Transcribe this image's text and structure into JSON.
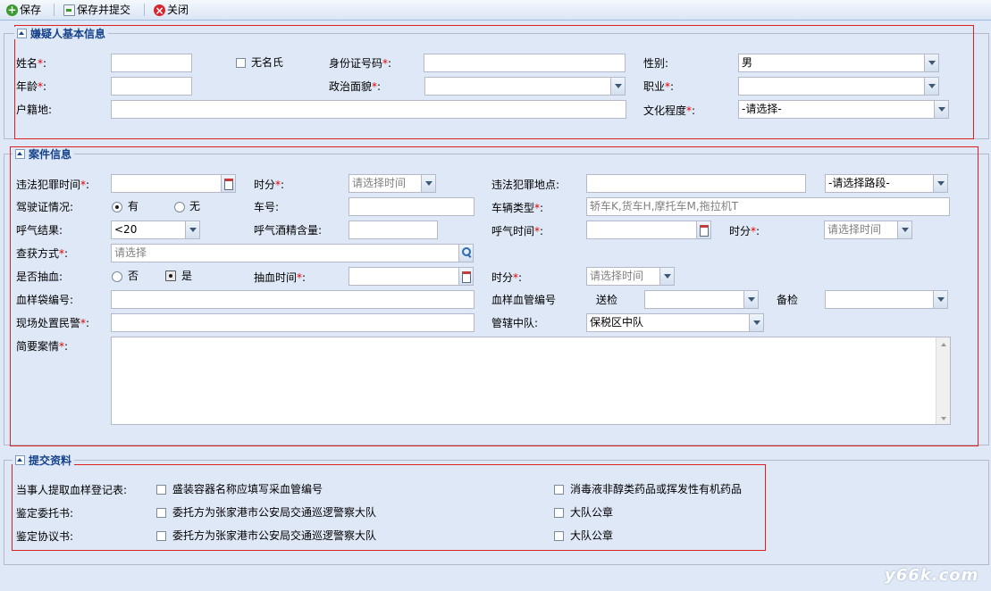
{
  "toolbar": {
    "save": "保存",
    "save_submit": "保存并提交",
    "close": "关闭"
  },
  "suspect": {
    "title": "嫌疑人基本信息",
    "name_label": "姓名",
    "no_name_label": "无名氏",
    "id_label": "身份证号码",
    "gender_label": "性别:",
    "gender_value": "男",
    "age_label": "年龄",
    "political_label": "政治面貌",
    "occupation_label": "职业",
    "domicile_label": "户籍地:",
    "education_label": "文化程度",
    "education_value": "-请选择-"
  },
  "case": {
    "title": "案件信息",
    "crime_time_label": "违法犯罪时间",
    "hour_label": "时分",
    "time_placeholder": "请选择时间",
    "crime_place_label": "违法犯罪地点:",
    "road_value": "-请选择路段-",
    "license_label": "驾驶证情况:",
    "license_yes": "有",
    "license_no": "无",
    "plate_label": "车号:",
    "vehicle_type_label": "车辆类型",
    "vehicle_type_placeholder": "轿车K,货车H,摩托车M,拖拉机T",
    "breath_result_label": "呼气结果:",
    "breath_result_value": "<20",
    "breath_alcohol_label": "呼气酒精含量:",
    "breath_time_label": "呼气时间",
    "seize_method_label": "查获方式",
    "seize_placeholder": "请选择",
    "blood_draw_label": "是否抽血:",
    "blood_no": "否",
    "blood_yes": "是",
    "blood_time_label": "抽血时间",
    "blood_bag_label": "血样袋编号:",
    "blood_tube_label": "血样血管编号",
    "send_label": "送检",
    "backup_label": "备检",
    "officer_label": "现场处置民警",
    "team_label": "管辖中队:",
    "team_value": "保税区中队",
    "summary_label": "简要案情"
  },
  "submit": {
    "title": "提交资料",
    "row1_label": "当事人提取血样登记表:",
    "row1_opt1": "盛装容器名称应填写采血管编号",
    "row1_opt2": "消毒液非醇类药品或挥发性有机药品",
    "row2_label": "鉴定委托书:",
    "row2_opt1": "委托方为张家港市公安局交通巡逻警察大队",
    "row2_opt2": "大队公章",
    "row3_label": "鉴定协议书:",
    "row3_opt1": "委托方为张家港市公安局交通巡逻警察大队",
    "row3_opt2": "大队公章"
  },
  "watermark": "y66k.com"
}
